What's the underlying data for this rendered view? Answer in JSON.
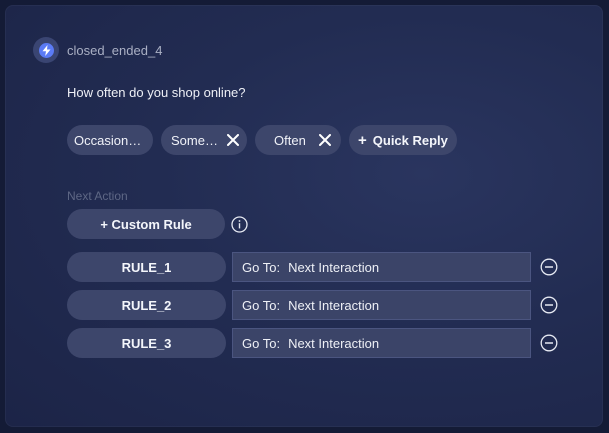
{
  "node": {
    "name": "closed_ended_4"
  },
  "question": "How often do you shop online?",
  "quick_replies": [
    {
      "label": "Occasionally"
    },
    {
      "label": "Sometimes"
    },
    {
      "label": "Often"
    }
  ],
  "add_quick_reply_label": "Quick Reply",
  "next_action": {
    "label": "Next Action",
    "custom_rule_label": "+ Custom Rule",
    "rules": [
      {
        "name": "RULE_1",
        "goto_prefix": "Go To:",
        "target": "Next Interaction"
      },
      {
        "name": "RULE_2",
        "goto_prefix": "Go To:",
        "target": "Next Interaction"
      },
      {
        "name": "RULE_3",
        "goto_prefix": "Go To:",
        "target": "Next Interaction"
      }
    ]
  },
  "colors": {
    "accent": "#5b7bf5",
    "pill": "#3d466b",
    "background": "#222c52"
  }
}
